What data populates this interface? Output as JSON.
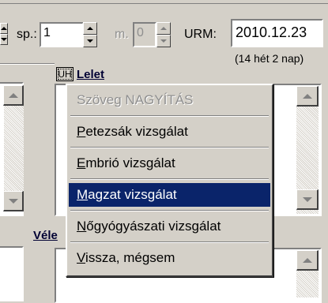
{
  "header": {
    "sp_label": "sp.:",
    "sp_value": "1",
    "m_label": "m.",
    "m_value": "0",
    "urm_label": "URM:",
    "urm_date": "2010.12.23",
    "urm_info": "(14 hét 2 nap)"
  },
  "lelet": {
    "uh_button": "UH",
    "label": "Lelet"
  },
  "velemeny": {
    "label_partial": "Véle"
  },
  "context_menu": {
    "items": [
      {
        "text": "Szöveg NAGYÍTÁS",
        "mnemonic": "",
        "rest": "Szöveg NAGYÍTÁS",
        "disabled": true
      },
      {
        "text": "Petezsák vizsgálat",
        "mnemonic": "P",
        "rest": "etezsák vizsgálat",
        "disabled": false
      },
      {
        "text": "Embrió vizsgálat",
        "mnemonic": "E",
        "rest": "mbrió vizsgálat",
        "disabled": false
      },
      {
        "text": "Magzat vizsgálat",
        "mnemonic": "M",
        "rest": "agzat vizsgálat",
        "disabled": false,
        "selected": true
      },
      {
        "text": "Nőgyógyászati vizsgálat",
        "mnemonic": "N",
        "rest": "őgyógyászati vizsgálat",
        "disabled": false
      },
      {
        "text": "Vissza, mégsem",
        "mnemonic": "V",
        "rest": "issza, mégsem",
        "disabled": false
      }
    ]
  },
  "colors": {
    "face": "#d4d0c8",
    "highlight": "#0a246a",
    "disabled_text": "#8f8f8f"
  }
}
